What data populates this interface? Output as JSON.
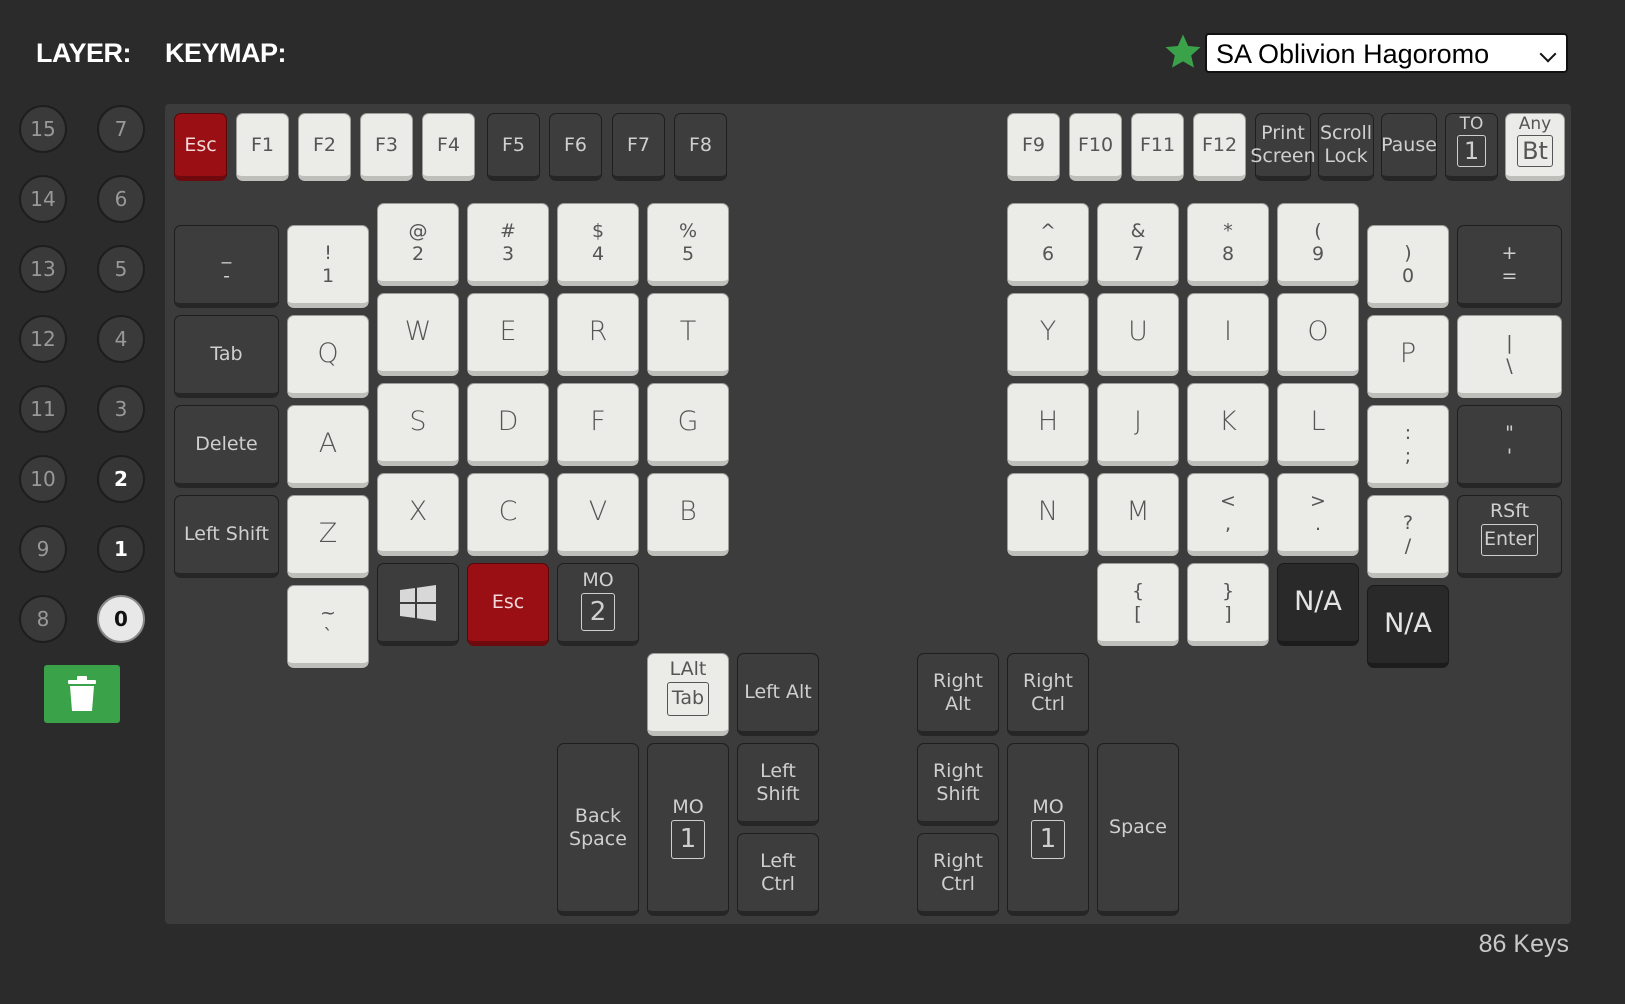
{
  "header": {
    "layer_label": "LAYER:",
    "keymap_label": "KEYMAP:",
    "keyset_select": "SA Oblivion Hagoromo",
    "favorite_color": "#3aa34a"
  },
  "layers": {
    "left_column": [
      "15",
      "14",
      "13",
      "12",
      "11",
      "10",
      "9",
      "8"
    ],
    "right_column": [
      "7",
      "6",
      "5",
      "4",
      "3",
      "2",
      "1",
      "0"
    ],
    "active": "0"
  },
  "footer": {
    "key_count": "86 Keys"
  },
  "keys": {
    "esc_top": "Esc",
    "f1": "F1",
    "f2": "F2",
    "f3": "F3",
    "f4": "F4",
    "f5": "F5",
    "f6": "F6",
    "f7": "F7",
    "f8": "F8",
    "f9": "F9",
    "f10": "F10",
    "f11": "F11",
    "f12": "F12",
    "print_a": "Print",
    "print_b": "Screen",
    "scroll_a": "Scroll",
    "scroll_b": "Lock",
    "pause": "Pause",
    "to_top": "TO",
    "to_val": "1",
    "any_top": "Any",
    "any_val": "Bt",
    "minus_a": "_",
    "minus_b": "-",
    "n1_a": "!",
    "n1_b": "1",
    "n2_a": "@",
    "n2_b": "2",
    "n3_a": "#",
    "n3_b": "3",
    "n4_a": "$",
    "n4_b": "4",
    "n5_a": "%",
    "n5_b": "5",
    "n6_a": "^",
    "n6_b": "6",
    "n7_a": "&",
    "n7_b": "7",
    "n8_a": "*",
    "n8_b": "8",
    "n9_a": "(",
    "n9_b": "9",
    "n0_a": ")",
    "n0_b": "0",
    "eq_a": "+",
    "eq_b": "=",
    "tab": "Tab",
    "q": "Q",
    "w": "W",
    "e": "E",
    "r": "R",
    "t": "T",
    "y": "Y",
    "u": "U",
    "i": "I",
    "o": "O",
    "p": "P",
    "bsl_a": "|",
    "bsl_b": "\\",
    "delete": "Delete",
    "a": "A",
    "s": "S",
    "d": "D",
    "f": "F",
    "g": "G",
    "h": "H",
    "j": "J",
    "k": "K",
    "l": "L",
    "semi_a": ":",
    "semi_b": ";",
    "quote_a": "\"",
    "quote_b": "'",
    "lshift": "Left Shift",
    "z": "Z",
    "x": "X",
    "c": "C",
    "v": "V",
    "b": "B",
    "n": "N",
    "m": "M",
    "comma_a": "<",
    "comma_b": ",",
    "dot_a": ">",
    "dot_b": ".",
    "slash_a": "?",
    "slash_b": "/",
    "rsft_top": "RSft",
    "rsft_val": "Enter",
    "grave_a": "~",
    "grave_b": "`",
    "esc_bottom": "Esc",
    "mo2_top": "MO",
    "mo2_val": "2",
    "lbr_a": "{",
    "lbr_b": "[",
    "rbr_a": "}",
    "rbr_b": "]",
    "na1": "N/A",
    "na2": "N/A",
    "lalt_top": "LAlt",
    "lalt_val": "Tab",
    "leftalt": "Left Alt",
    "rightalt_a": "Right",
    "rightalt_b": "Alt",
    "rightctrl1_a": "Right",
    "rightctrl1_b": "Ctrl",
    "bksp_a": "Back",
    "bksp_b": "Space",
    "mo1l_top": "MO",
    "mo1l_val": "1",
    "lshift2_a": "Left",
    "lshift2_b": "Shift",
    "lctrl_a": "Left",
    "lctrl_b": "Ctrl",
    "rshift2_a": "Right",
    "rshift2_b": "Shift",
    "rctrl2_a": "Right",
    "rctrl2_b": "Ctrl",
    "mo1r_top": "MO",
    "mo1r_val": "1",
    "space": "Space"
  }
}
